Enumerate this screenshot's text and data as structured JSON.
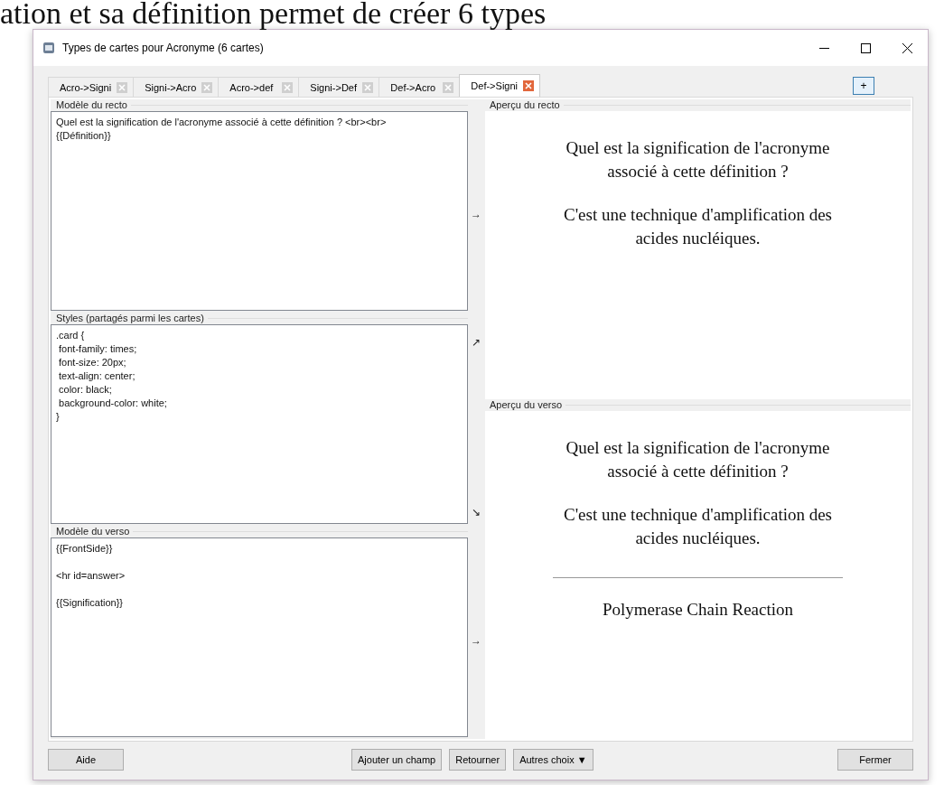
{
  "background": {
    "heading": "ation et sa définition permet de créer 6 types"
  },
  "window": {
    "title": "Types de cartes pour Acronyme (6 cartes)"
  },
  "tabs": [
    {
      "label": "Acro->Signi",
      "selected": false
    },
    {
      "label": "Signi->Acro",
      "selected": false
    },
    {
      "label": "Acro->def",
      "selected": false
    },
    {
      "label": "Signi->Def",
      "selected": false
    },
    {
      "label": "Def->Acro",
      "selected": false
    },
    {
      "label": "Def->Signi",
      "selected": true
    }
  ],
  "add_tab_button": "+",
  "editors": [
    {
      "label": "Modèle du recto",
      "lines": [
        "Quel est la signification de l'acronyme associé à cette définition ? <br><br>",
        "{{Définition}}"
      ],
      "arrows": [
        "→"
      ]
    },
    {
      "label": "Styles (partagés parmi les cartes)",
      "lines": [
        ".card {",
        " font-family: times;",
        " font-size: 20px;",
        " text-align: center;",
        " color: black;",
        " background-color: white;",
        "}"
      ],
      "arrows": [
        "↗",
        "↘"
      ]
    },
    {
      "label": "Modèle du verso",
      "lines": [
        "{{FrontSide}}",
        "<hr id=answer>",
        "{{Signification}}"
      ],
      "blank_lines": true,
      "arrows": [
        "→"
      ]
    }
  ],
  "previews": [
    {
      "label": "Aperçu du recto",
      "blocks": [
        {
          "kind": "text",
          "text": "Quel est la signification de l'acronyme associé à cette définition ?"
        },
        {
          "kind": "text",
          "text": "C'est une technique d'amplification des acides nucléiques."
        }
      ]
    },
    {
      "label": "Aperçu du verso",
      "blocks": [
        {
          "kind": "text",
          "text": "Quel est la signification de l'acronyme associé à cette définition ?"
        },
        {
          "kind": "text",
          "text": "C'est une technique d'amplification des acides nucléiques."
        },
        {
          "kind": "rule"
        },
        {
          "kind": "text",
          "text": "Polymerase Chain Reaction"
        }
      ]
    }
  ],
  "buttons": {
    "left": [
      "Aide"
    ],
    "center": [
      "Ajouter un champ",
      "Retourner",
      "Autres choix ▼"
    ],
    "right": [
      "Fermer"
    ]
  }
}
